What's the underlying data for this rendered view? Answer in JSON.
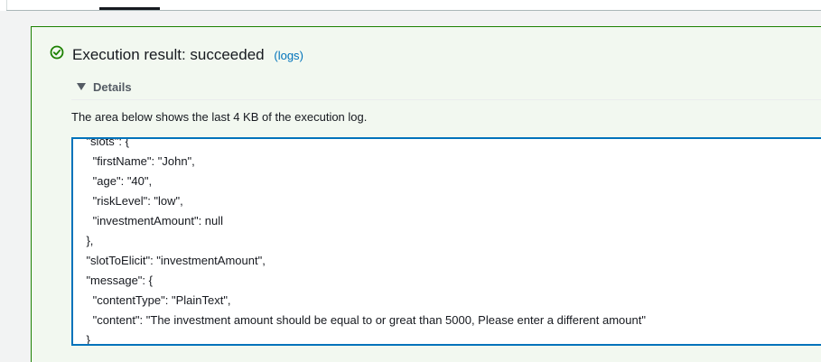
{
  "result": {
    "title": "Execution result: succeeded",
    "logs_open_paren": "(",
    "logs_link": "logs",
    "logs_close_paren": ")",
    "status_color": "#1d8102",
    "status_icon": "check-circle-icon"
  },
  "details": {
    "label": "Details",
    "expanded": true,
    "description": "The area below shows the last 4 KB of the execution log."
  },
  "log_lines": [
    "    \"slots\": {",
    "      \"firstName\": \"John\",",
    "      \"age\": \"40\",",
    "      \"riskLevel\": \"low\",",
    "      \"investmentAmount\": null",
    "    },",
    "    \"slotToElicit\": \"investmentAmount\",",
    "    \"message\": {",
    "      \"contentType\": \"PlainText\",",
    "      \"content\": \"The investment amount should be equal to or great than 5000, Please enter a different amount\"",
    "    }"
  ],
  "colors": {
    "accent_link": "#0073bb",
    "success": "#1d8102",
    "panel_bg": "#f2f8f0"
  }
}
